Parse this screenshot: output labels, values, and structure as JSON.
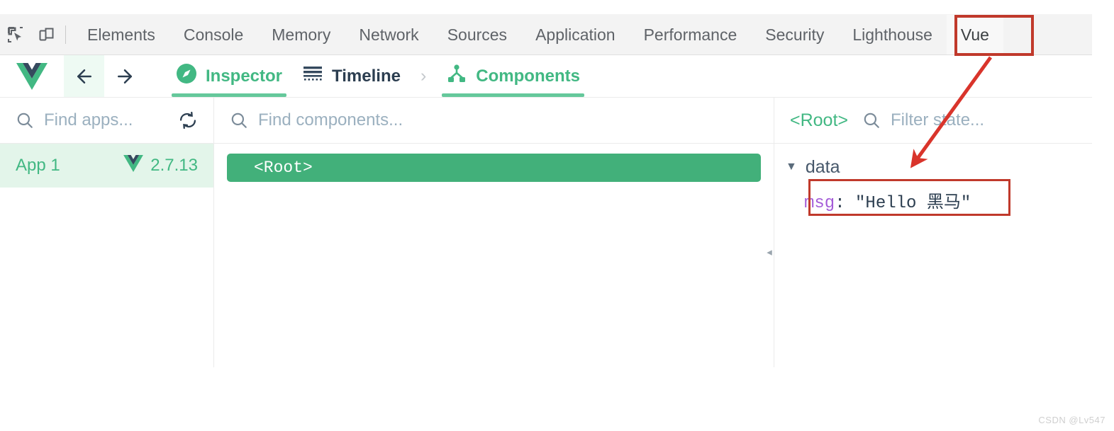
{
  "devtools": {
    "icons": {
      "inspect": "inspect-element-icon",
      "device": "device-toolbar-icon"
    },
    "tabs": [
      {
        "label": "Elements",
        "active": false
      },
      {
        "label": "Console",
        "active": false
      },
      {
        "label": "Memory",
        "active": false
      },
      {
        "label": "Network",
        "active": false
      },
      {
        "label": "Sources",
        "active": false
      },
      {
        "label": "Application",
        "active": false
      },
      {
        "label": "Performance",
        "active": false
      },
      {
        "label": "Security",
        "active": false
      },
      {
        "label": "Lighthouse",
        "active": false
      },
      {
        "label": "Vue",
        "active": true
      }
    ]
  },
  "vue_toolbar": {
    "logo": "vue-logo-icon",
    "back": "arrow-left-icon",
    "forward": "arrow-right-icon",
    "tabs": [
      {
        "label": "Inspector",
        "icon": "compass-icon",
        "active": true
      },
      {
        "label": "Timeline",
        "icon": "timeline-icon",
        "active": false
      },
      {
        "label": "Components",
        "icon": "component-tree-icon",
        "active": true
      }
    ],
    "separator": "›"
  },
  "apps_pane": {
    "search": {
      "placeholder": "Find apps...",
      "value": "",
      "icon": "search-icon"
    },
    "refresh_icon": "refresh-icon",
    "items": [
      {
        "name": "App 1",
        "version": "2.7.13",
        "icon": "vue-logo-icon",
        "selected": true
      }
    ]
  },
  "components_pane": {
    "search": {
      "placeholder": "Find components...",
      "value": "",
      "icon": "search-icon"
    },
    "tree": [
      {
        "label": "<Root>",
        "selected": true
      }
    ],
    "collapse_handle": "◂"
  },
  "state_pane": {
    "component_name": "<Root>",
    "search": {
      "placeholder": "Filter state...",
      "value": "",
      "icon": "search-icon"
    },
    "groups": [
      {
        "name": "data",
        "expanded": true,
        "triangle": "▼",
        "props": [
          {
            "key": "msg",
            "separator": ": ",
            "value": "\"Hello 黑马\""
          }
        ]
      }
    ]
  },
  "annotations": {
    "accent_color": "#c0392b",
    "highlight_tab": "Vue",
    "highlight_prop": "msg"
  },
  "watermark": "CSDN @Lv547",
  "colors": {
    "vue_green": "#42b883",
    "vue_green_dark": "#42b07a",
    "selected_app_bg": "#e3f5ea",
    "purple_key": "#a45cd8",
    "devtools_bar_bg": "#f3f3f3",
    "annotation_red": "#c0392b"
  }
}
